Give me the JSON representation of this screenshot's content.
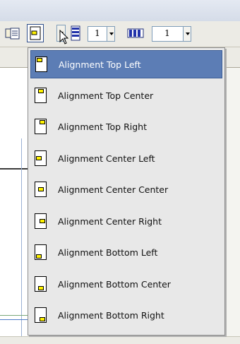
{
  "toolbar": {
    "row_spacing_value": "1",
    "column_spacing_value": "1"
  },
  "menu": {
    "items": [
      {
        "label": "Alignment Top Left",
        "icon": "align-top-left-icon",
        "v": "top",
        "h": "left",
        "selected": true
      },
      {
        "label": "Alignment Top Center",
        "icon": "align-top-center-icon",
        "v": "top",
        "h": "center",
        "selected": false
      },
      {
        "label": "Alignment Top Right",
        "icon": "align-top-right-icon",
        "v": "top",
        "h": "right",
        "selected": false
      },
      {
        "label": "Alignment Center Left",
        "icon": "align-center-left-icon",
        "v": "center",
        "h": "left",
        "selected": false
      },
      {
        "label": "Alignment Center Center",
        "icon": "align-center-center-icon",
        "v": "center",
        "h": "center",
        "selected": false
      },
      {
        "label": "Alignment Center Right",
        "icon": "align-center-right-icon",
        "v": "center",
        "h": "right",
        "selected": false
      },
      {
        "label": "Alignment Bottom Left",
        "icon": "align-bottom-left-icon",
        "v": "bottom",
        "h": "left",
        "selected": false
      },
      {
        "label": "Alignment Bottom Center",
        "icon": "align-bottom-center-icon",
        "v": "bottom",
        "h": "center",
        "selected": false
      },
      {
        "label": "Alignment Bottom Right",
        "icon": "align-bottom-right-icon",
        "v": "bottom",
        "h": "right",
        "selected": false
      }
    ]
  },
  "colors": {
    "selection": "#5c7db5",
    "menu_background": "#e8e8e8",
    "alignment_marker": "#fff200"
  }
}
